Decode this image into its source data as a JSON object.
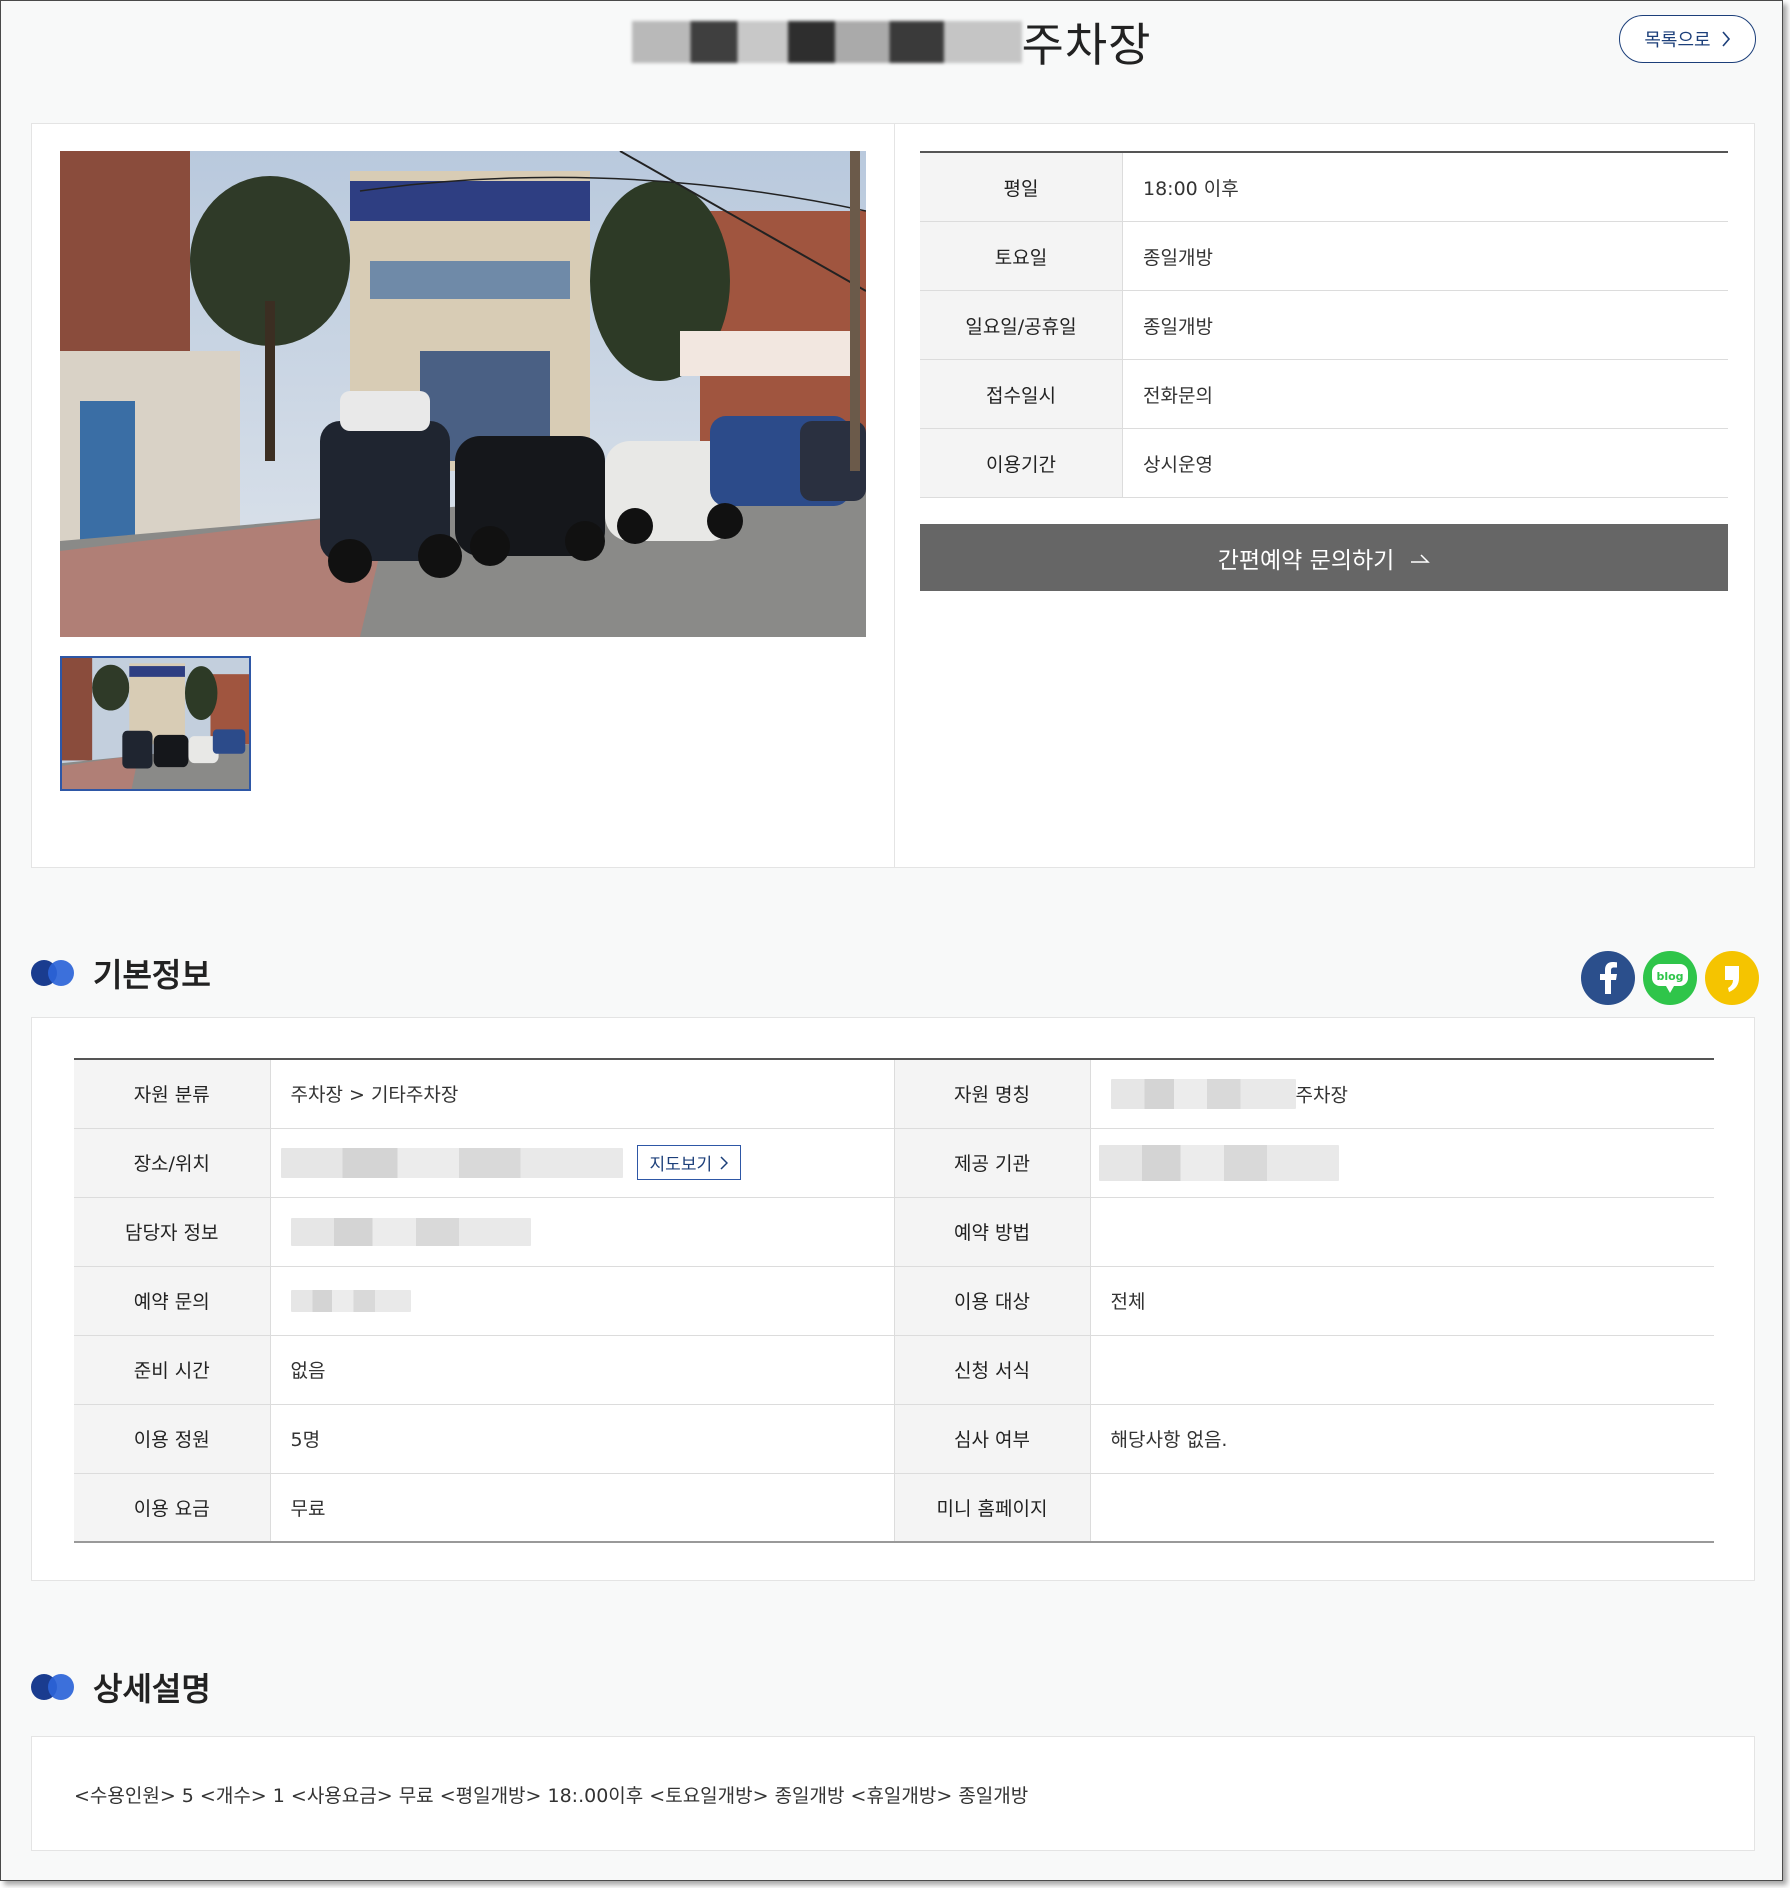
{
  "header": {
    "title_suffix": "주차장",
    "list_button_label": "목록으로"
  },
  "schedule": [
    {
      "label": "평일",
      "value": "18:00 이후"
    },
    {
      "label": "토요일",
      "value": "종일개방"
    },
    {
      "label": "일요일/공휴일",
      "value": "종일개방"
    },
    {
      "label": "접수일시",
      "value": "전화문의"
    },
    {
      "label": "이용기간",
      "value": "상시운영"
    }
  ],
  "reserve_button_label": "간편예약 문의하기",
  "basic_info": {
    "heading": "기본정보",
    "social": [
      "facebook-icon",
      "blog-icon",
      "kakao-story-icon"
    ],
    "rows": [
      {
        "l_label": "자원 분류",
        "l_value": "주차장 > 기타주차장",
        "r_label": "자원 명칭",
        "r_value": "주차장"
      },
      {
        "l_label": "장소/위치",
        "l_value": "",
        "map_button": "지도보기",
        "r_label": "제공 기관",
        "r_value": ""
      },
      {
        "l_label": "담당자 정보",
        "l_value": "",
        "r_label": "예약 방법",
        "r_value": ""
      },
      {
        "l_label": "예약 문의",
        "l_value": "",
        "r_label": "이용 대상",
        "r_value": "전체"
      },
      {
        "l_label": "준비 시간",
        "l_value": "없음",
        "r_label": "신청 서식",
        "r_value": ""
      },
      {
        "l_label": "이용 정원",
        "l_value": "5명",
        "r_label": "심사 여부",
        "r_value": "해당사항 없음."
      },
      {
        "l_label": "이용 요금",
        "l_value": "무료",
        "r_label": "미니 홈페이지",
        "r_value": ""
      }
    ]
  },
  "detail": {
    "heading": "상세설명",
    "text": "<수용인원> 5 <개수> 1 <사용요금> 무료 <평일개방> 18:.00이후 <토요일개방> 종일개방 <휴일개방> 종일개방"
  },
  "colors": {
    "accent_navy": "#1c3f7a",
    "button_gray": "#666666",
    "facebook": "#2b4f8c",
    "blog": "#2fc54a",
    "kakao": "#f5c400"
  }
}
